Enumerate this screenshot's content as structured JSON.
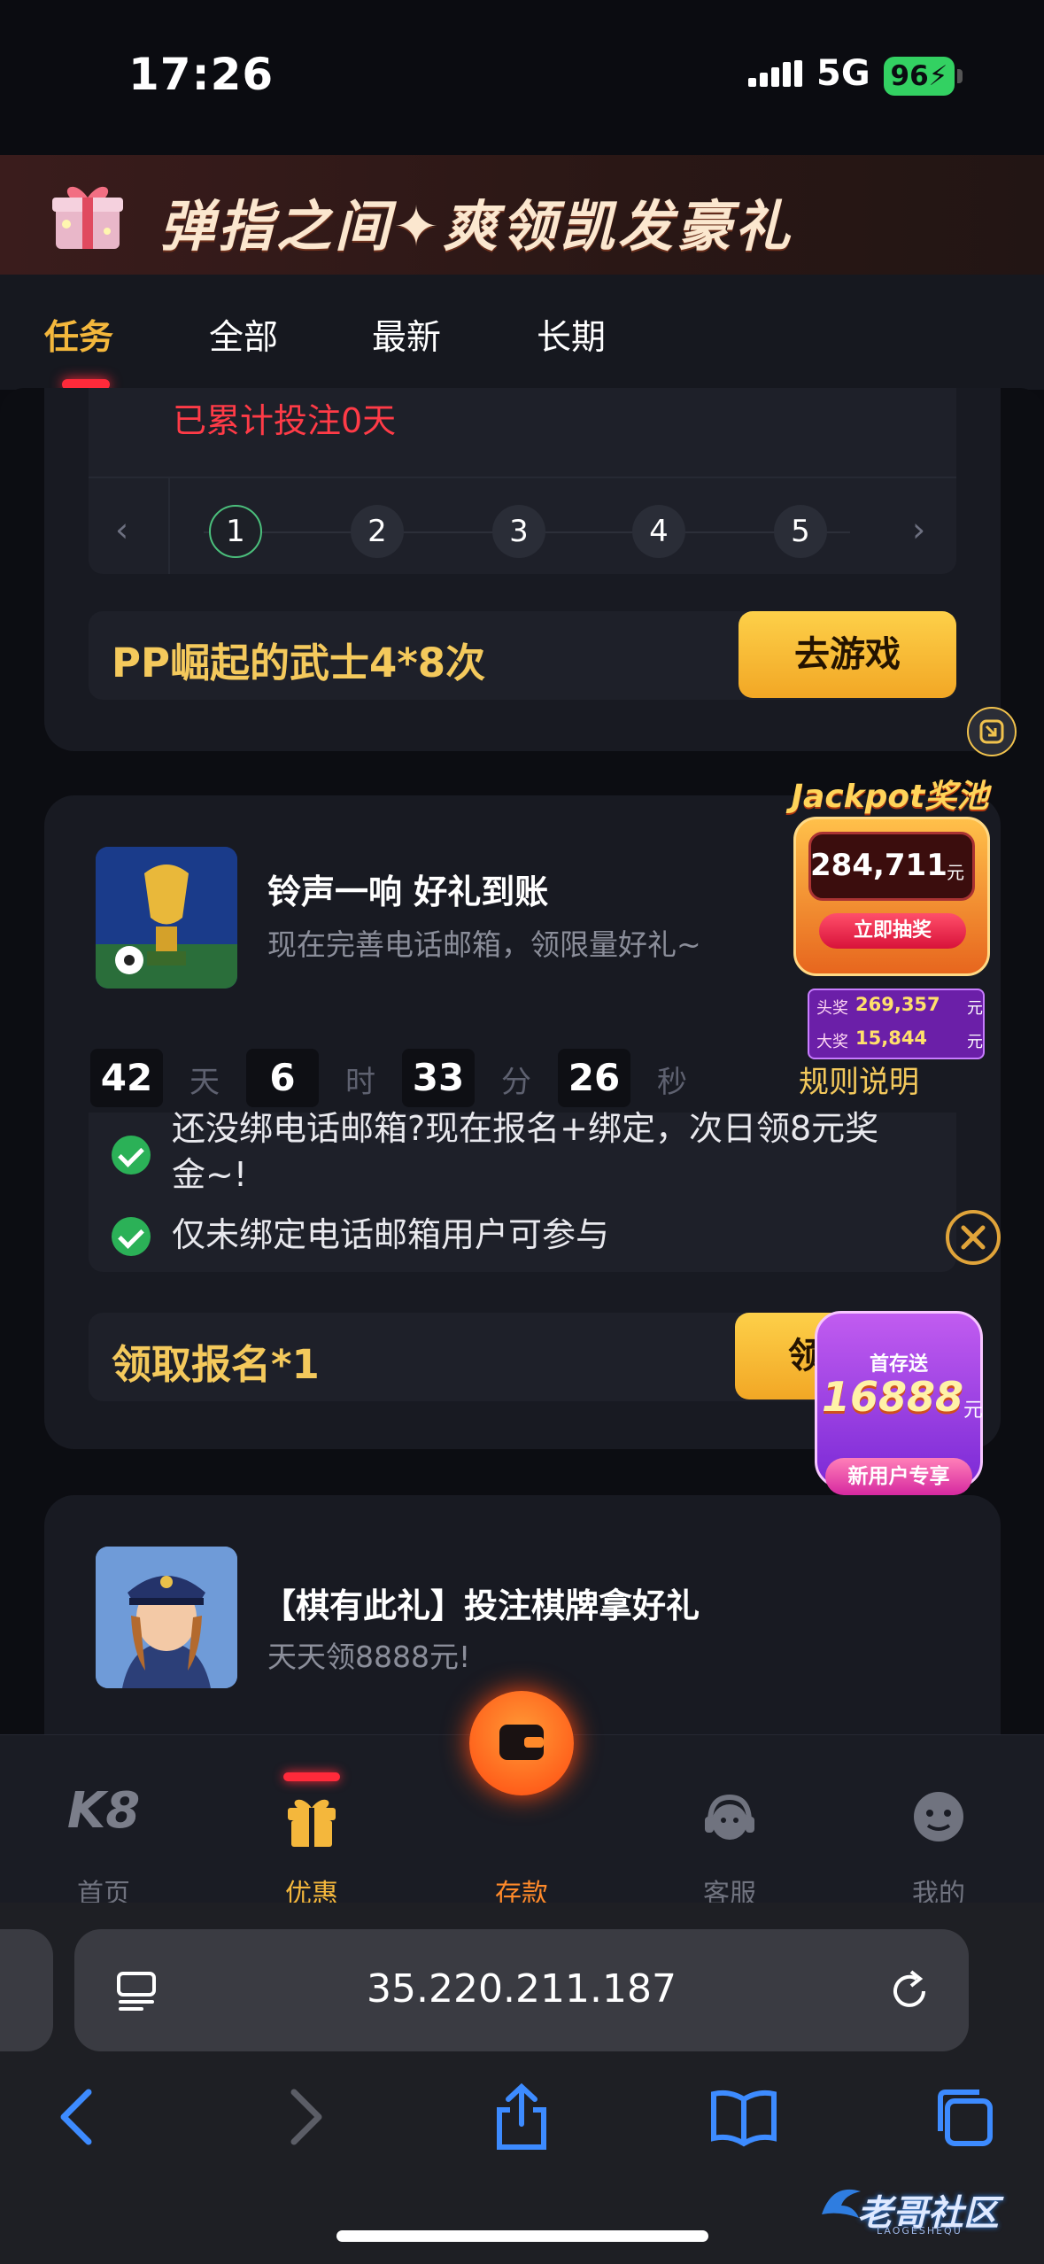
{
  "status_bar": {
    "time": "17:26",
    "network": "5G",
    "battery": "96"
  },
  "banner": {
    "title": "弹指之间✦爽领凯发豪礼"
  },
  "tabs": [
    {
      "label": "任务",
      "active": true
    },
    {
      "label": "全部",
      "active": false
    },
    {
      "label": "最新",
      "active": false
    },
    {
      "label": "长期",
      "active": false
    }
  ],
  "card1": {
    "progress_text": "已累计投注0天",
    "pages": [
      "1",
      "2",
      "3",
      "4",
      "5"
    ],
    "selected_page": "1",
    "task_label": "PP崛起的武士4*8次",
    "task_button": "去游戏"
  },
  "card2": {
    "title": "铃声一响 好礼到账",
    "subtitle": "现在完善电话邮箱，领限量好礼~",
    "countdown": [
      {
        "value": "42",
        "unit": "天"
      },
      {
        "value": "6",
        "unit": "时"
      },
      {
        "value": "33",
        "unit": "分"
      },
      {
        "value": "26",
        "unit": "秒"
      }
    ],
    "rules_link": "规则说明",
    "conditions": [
      "还没绑电话邮箱?现在报名+绑定，次日领8元奖金~!",
      "仅未绑定电话邮箱用户可参与"
    ],
    "task_label": "领取报名*1",
    "task_button": "领"
  },
  "card3": {
    "title": "【棋有此礼】投注棋牌拿好礼",
    "subtitle": "天天领8888元!"
  },
  "jackpot": {
    "title": "Jackpot奖池",
    "amount": "284,711",
    "currency": "元",
    "draw_button": "立即抽奖",
    "rows": [
      {
        "label": "头奖",
        "value": "269,357",
        "unit": "元"
      },
      {
        "label": "大奖",
        "value": "15,844",
        "unit": "元"
      }
    ]
  },
  "deposit_promo": {
    "top": "首存送",
    "amount": "16888",
    "unit": "元",
    "tag": "新用户专享"
  },
  "bottom_nav": [
    {
      "label": "首页",
      "icon": "k8-logo-icon",
      "active": false
    },
    {
      "label": "优惠",
      "icon": "gift-icon",
      "active": true
    },
    {
      "label": "存款",
      "icon": "wallet-icon",
      "active": false
    },
    {
      "label": "客服",
      "icon": "headset-icon",
      "active": false
    },
    {
      "label": "我的",
      "icon": "user-icon",
      "active": false
    }
  ],
  "nav_logo": "K8",
  "browser": {
    "url": "35.220.211.187"
  },
  "watermark": {
    "text": "老哥社区",
    "sub": "LAOGESHEQU"
  },
  "colors": {
    "accent": "#f4b73c",
    "red": "#ff2a3a",
    "green": "#2bb157"
  }
}
